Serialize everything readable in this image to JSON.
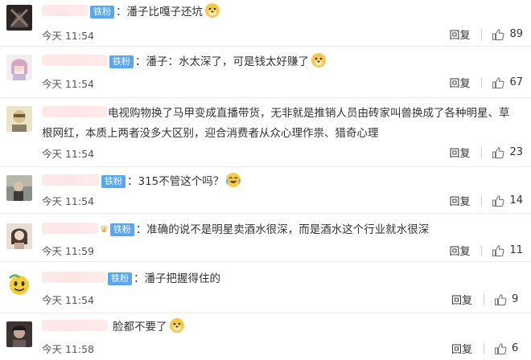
{
  "colors": {
    "badge": "#58a6ef",
    "divider": "#ececec"
  },
  "comments": [
    {
      "badge": "铁粉",
      "colon": "：",
      "text": "潘子比嘎子还坑",
      "emoji": "doge-emoji",
      "time": "今天 11:54",
      "reply": "回复",
      "likes": "89"
    },
    {
      "badge": "铁粉",
      "colon": "：",
      "text": "潘子：水太深了，可是钱太好赚了",
      "emoji": "doge-emoji",
      "time": "今天 11:54",
      "reply": "回复",
      "likes": "67"
    },
    {
      "badge": "",
      "colon": "：",
      "text": "电视购物换了马甲变成直播带货，无非就是推销人员由砖家叫兽换成了各种明星、草根网红，本质上两者没多大区别，迎合消费者从众心理作祟、猎奇心理",
      "emoji": "",
      "time": "今天 11:54",
      "reply": "回复",
      "likes": "23"
    },
    {
      "badge": "铁粉",
      "colon": "：",
      "text": "315不管这个吗？",
      "emoji": "laugh-cry-emoji",
      "time": "今天 11:54",
      "reply": "回复",
      "likes": "14"
    },
    {
      "badge": "铁粉",
      "colon": "：",
      "text": "准确的说不是明星卖酒水很深，而是酒水这个行业就水很深",
      "emoji": "",
      "time": "今天 11:59",
      "reply": "回复",
      "likes": "11"
    },
    {
      "badge": "铁粉",
      "colon": "：",
      "text": "潘子把握得住的",
      "emoji": "",
      "time": "今天 11:54",
      "reply": "回复",
      "likes": "9"
    },
    {
      "badge": "",
      "colon": "：",
      "text": "脸都不要了",
      "emoji": "doge-emoji",
      "time": "今天 11:58",
      "reply": "回复",
      "likes": "6"
    }
  ]
}
